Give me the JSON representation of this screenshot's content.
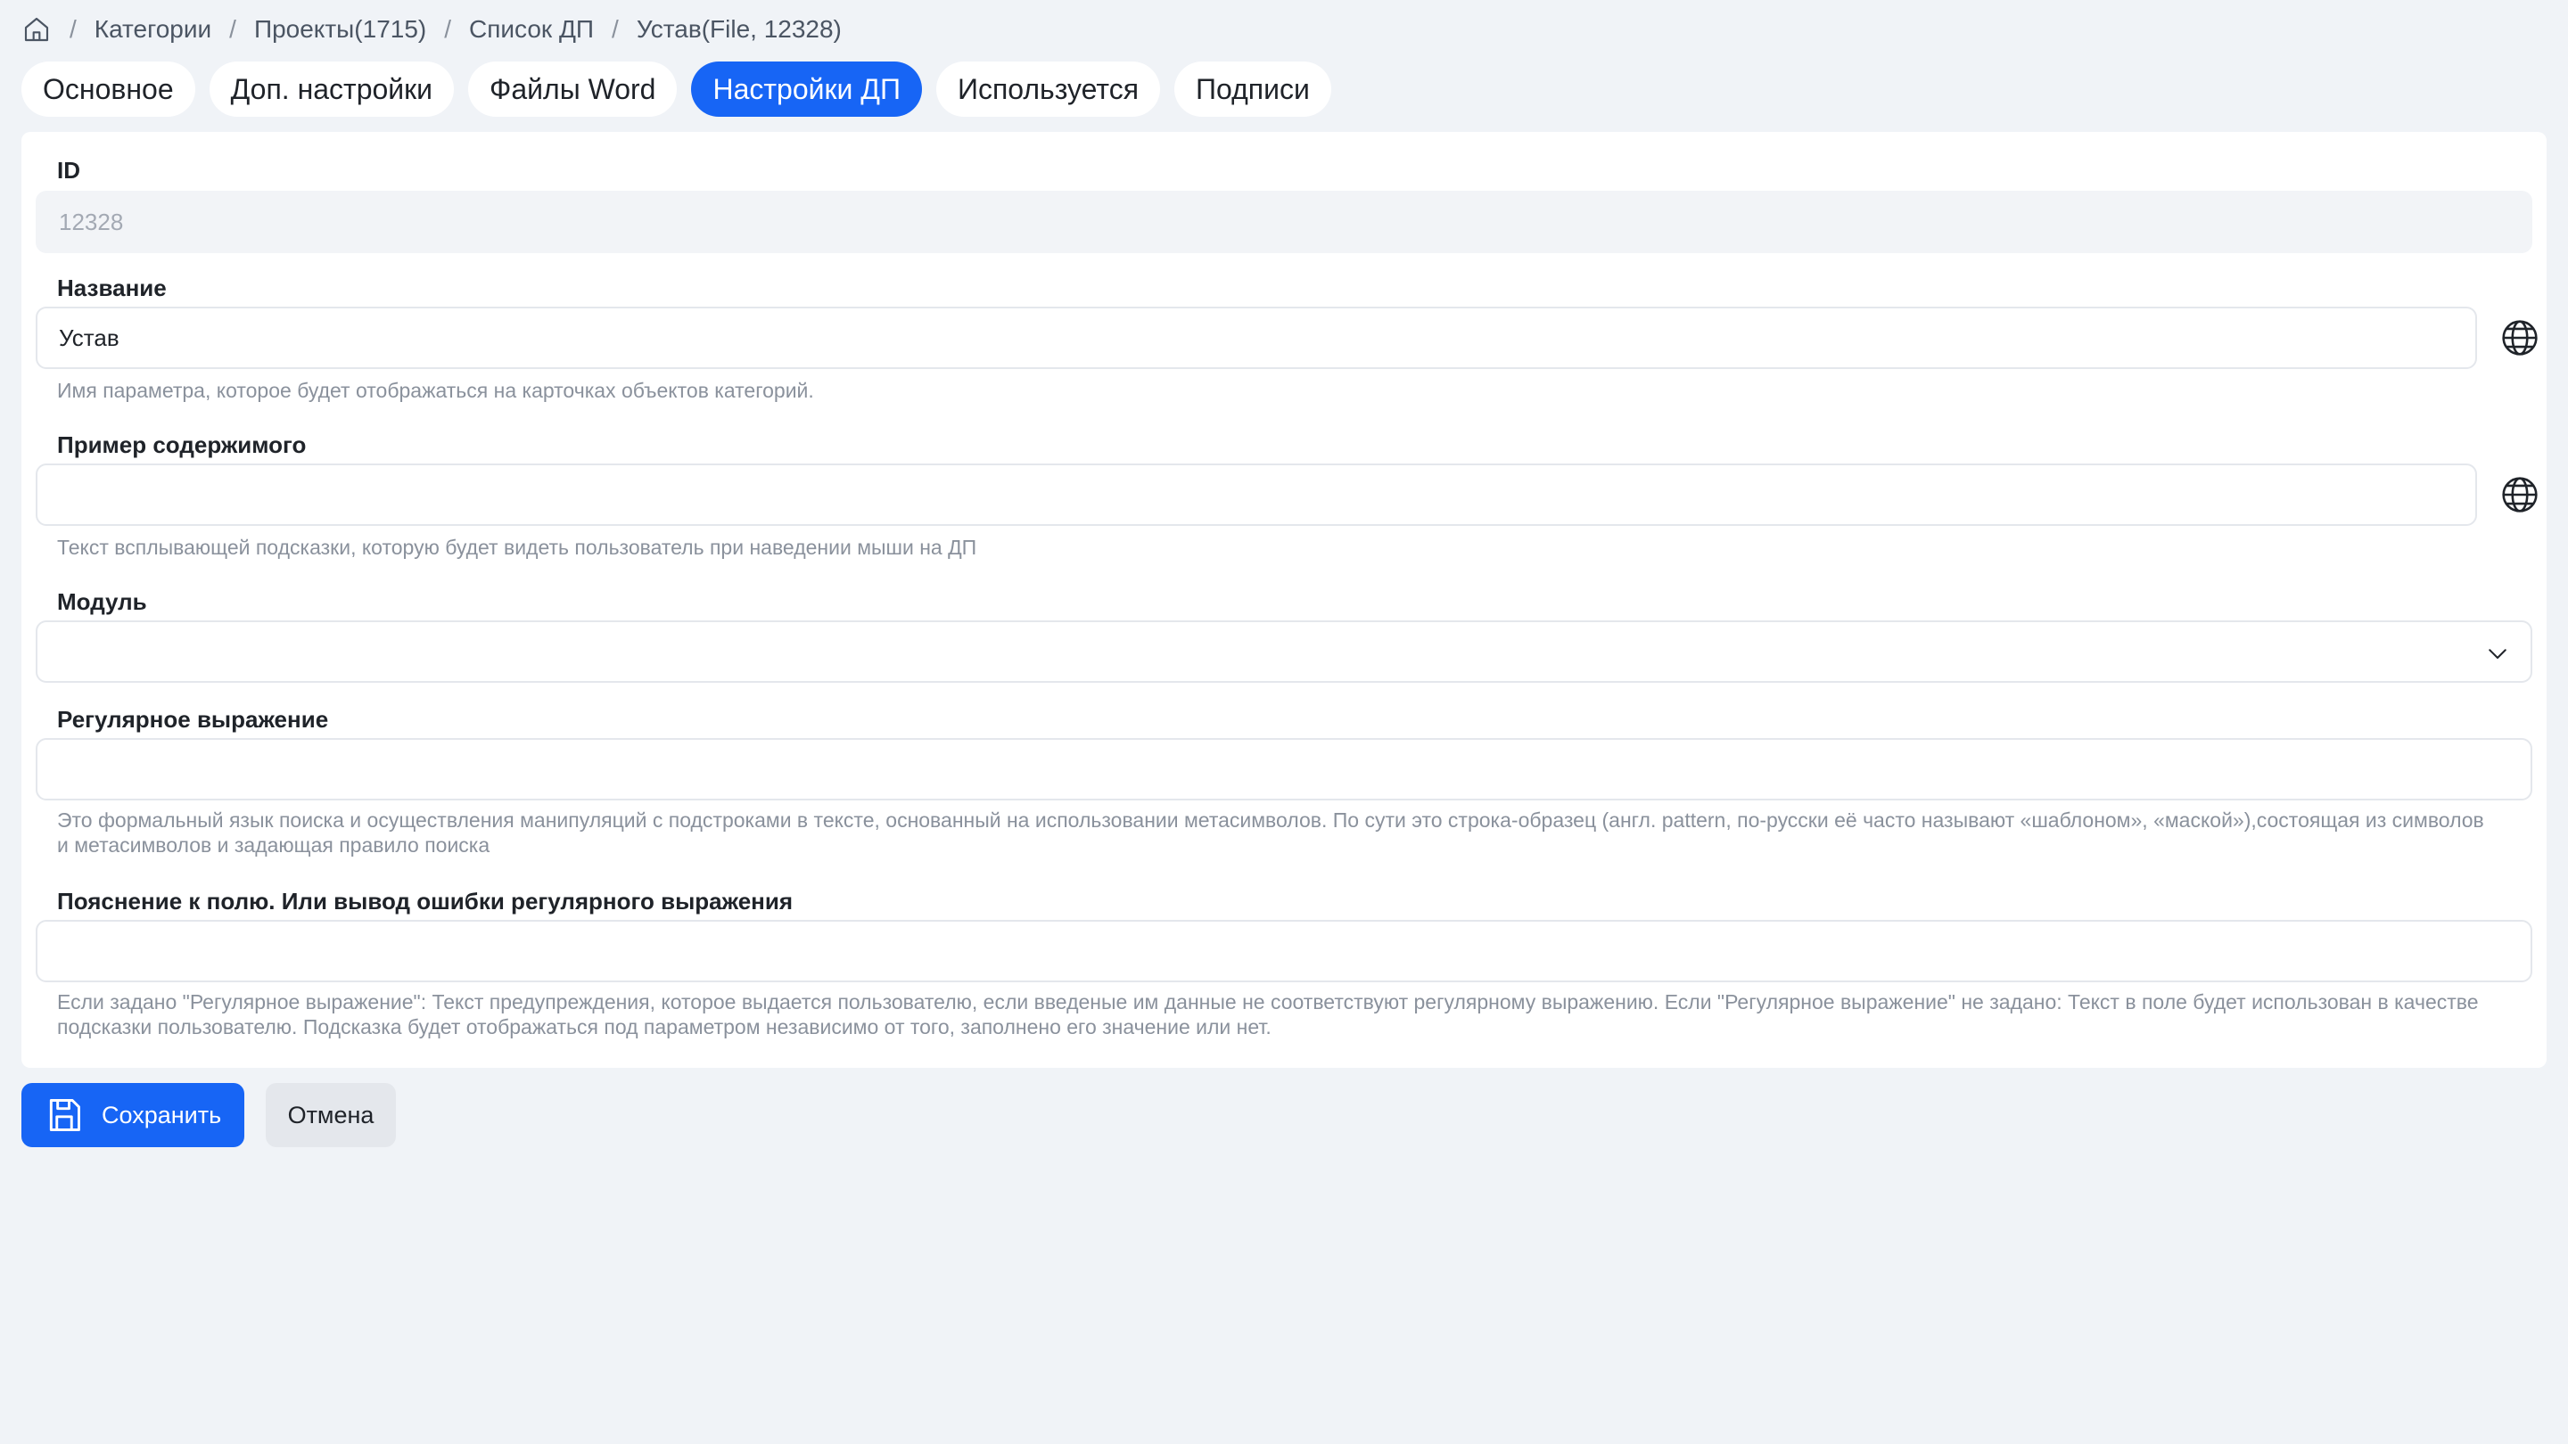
{
  "breadcrumb": {
    "home_icon": "home-icon",
    "separator": "/",
    "items": [
      "Категории",
      "Проекты(1715)",
      "Список ДП",
      "Устав(File, 12328)"
    ]
  },
  "tabs": [
    {
      "label": "Основное",
      "active": false
    },
    {
      "label": "Доп. настройки",
      "active": false
    },
    {
      "label": "Файлы Word",
      "active": false
    },
    {
      "label": "Настройки ДП",
      "active": true
    },
    {
      "label": "Используется",
      "active": false
    },
    {
      "label": "Подписи",
      "active": false
    }
  ],
  "form": {
    "id": {
      "label": "ID",
      "value": "12328"
    },
    "name": {
      "label": "Название",
      "value": "Устав",
      "hint": "Имя параметра, которое будет отображаться на карточках объектов категорий.",
      "icon": "globe-icon"
    },
    "example": {
      "label": "Пример содержимого",
      "value": "",
      "hint": "Текст всплывающей подсказки, которую будет видеть пользователь при наведении мыши на ДП",
      "icon": "globe-icon"
    },
    "module": {
      "label": "Модуль",
      "value": "",
      "icon": "chevron-down-icon"
    },
    "regex": {
      "label": "Регулярное выражение",
      "value": "",
      "hint": "Это формальный язык поиска и осуществления манипуляций с подстроками в тексте, основанный на использовании метасимволов. По сути это строка-образец (англ. pattern, по-русски её часто называют «шаблоном», «маской»),состоящая из символов и метасимволов и задающая правило поиска"
    },
    "explanation": {
      "label": "Пояснение к полю. Или вывод ошибки регулярного выражения",
      "value": "",
      "hint": "Если задано \"Регулярное выражение\": Текст предупреждения, которое выдается пользователю, если введеные им данные не соответствуют регулярному выражению. Если \"Регулярное выражение\" не задано: Текст в поле будет использован в качестве подсказки пользователю. Подсказка будет отображаться под параметром независимо от того, заполнено его значение или нет."
    }
  },
  "actions": {
    "save_label": "Сохранить",
    "save_icon": "save-icon",
    "cancel_label": "Отмена"
  },
  "colors": {
    "accent": "#1765f5",
    "background": "#f0f3f7",
    "card": "#ffffff"
  }
}
